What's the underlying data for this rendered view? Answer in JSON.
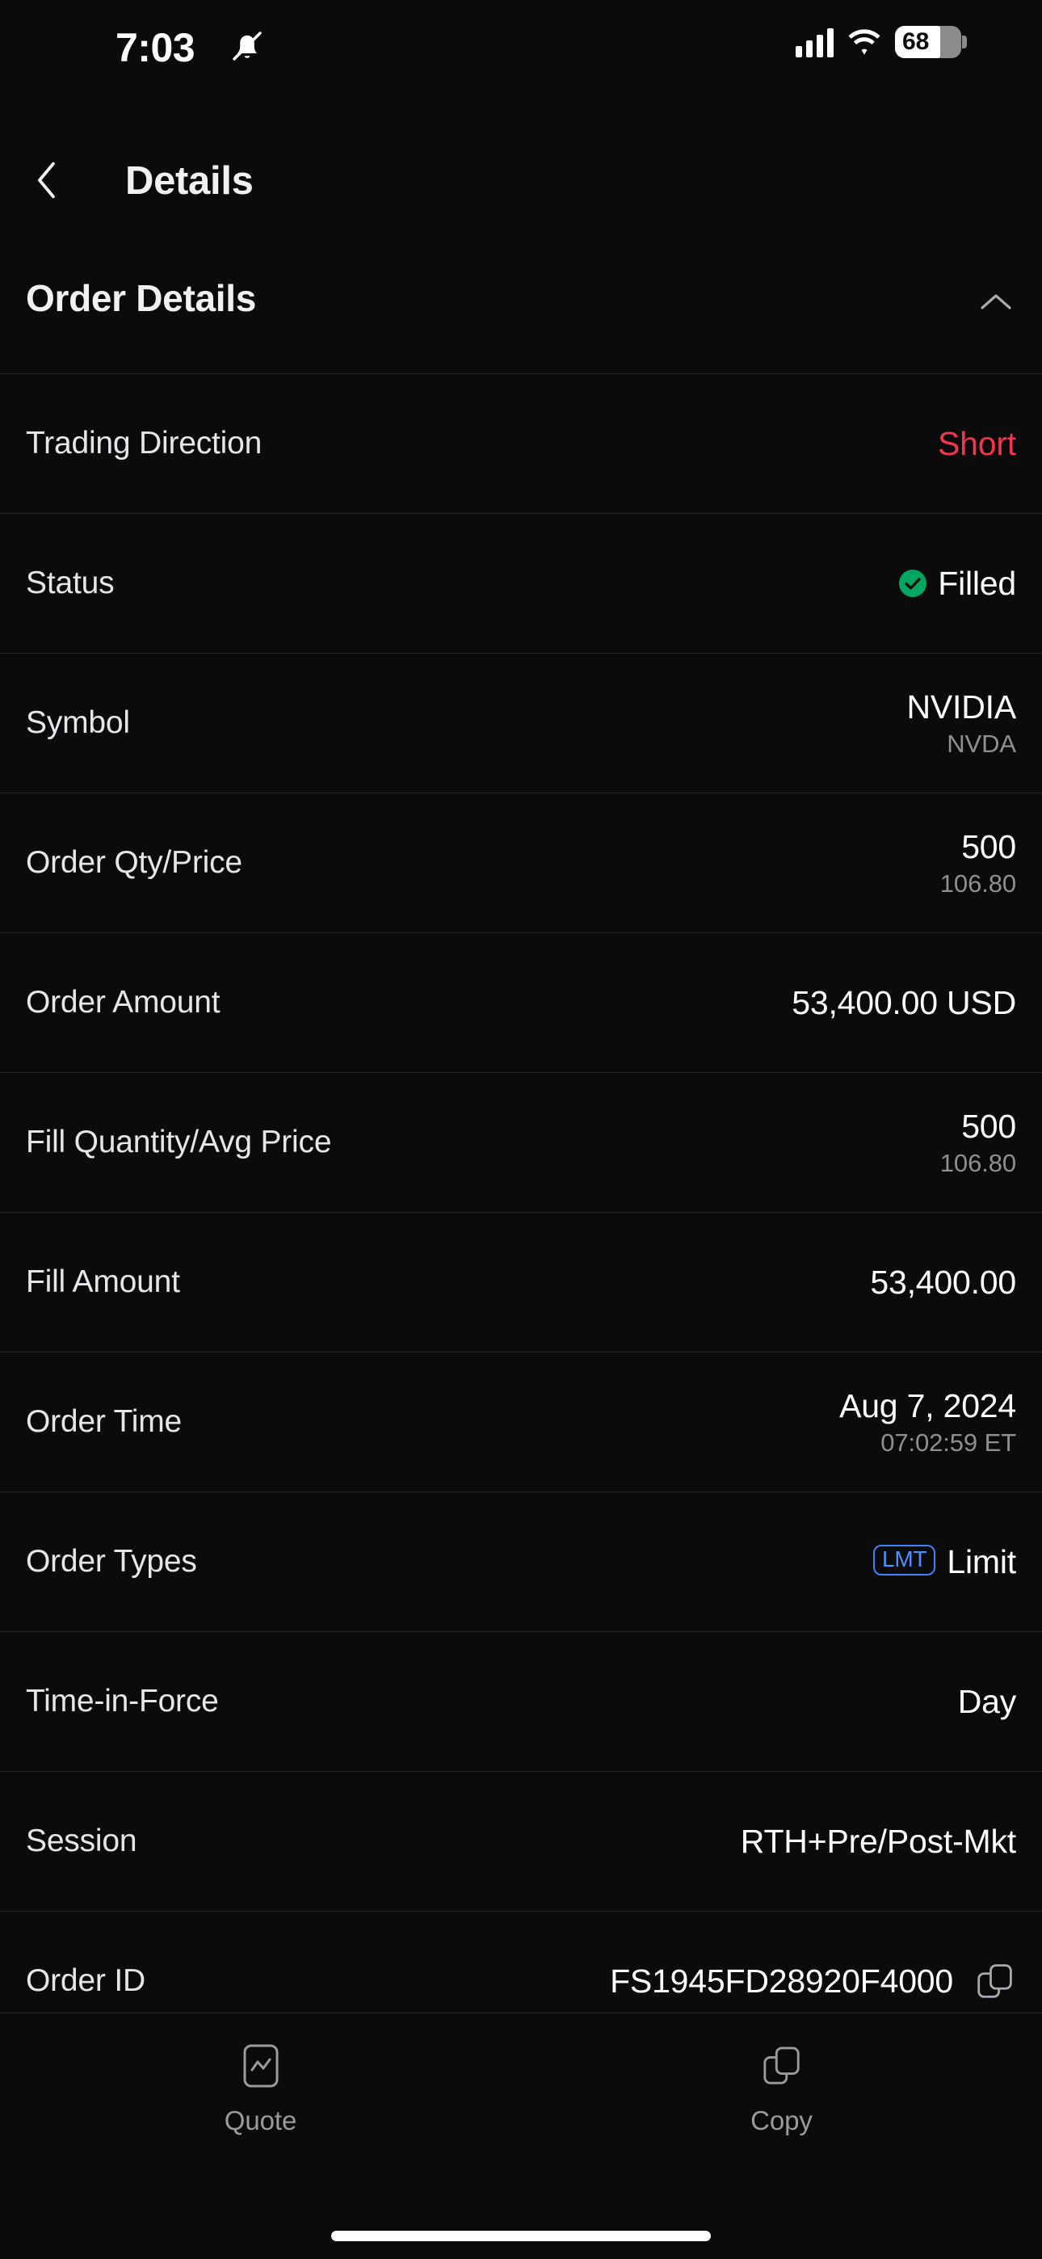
{
  "status_bar": {
    "time": "7:03",
    "silent_icon": "bell-slash-icon",
    "cellular_icon": "cellular-bars-icon",
    "wifi_icon": "wifi-icon",
    "battery_percent": "68"
  },
  "nav": {
    "back_icon": "chevron-left-icon",
    "title": "Details"
  },
  "section": {
    "title": "Order Details",
    "collapse_icon": "chevron-up-icon"
  },
  "colors": {
    "background": "#0b0b0c",
    "divider": "#262628",
    "short_red": "#f2364d",
    "filled_green": "#03a660",
    "badge_blue": "#4a90ff",
    "label_gray": "#e6e6ea",
    "subvalue_gray": "#8e8e93"
  },
  "rows": [
    {
      "label": "Trading Direction",
      "value": "Short",
      "sub": "",
      "style": "short"
    },
    {
      "label": "Status",
      "value": "Filled",
      "sub": "",
      "style": "filled"
    },
    {
      "label": "Symbol",
      "value": "NVIDIA",
      "sub": "NVDA",
      "style": "plain"
    },
    {
      "label": "Order Qty/Price",
      "value": "500",
      "sub": "106.80",
      "style": "plain"
    },
    {
      "label": "Order Amount",
      "value": "53,400.00 USD",
      "sub": "",
      "style": "plain"
    },
    {
      "label": "Fill Quantity/Avg Price",
      "value": "500",
      "sub": "106.80",
      "style": "plain"
    },
    {
      "label": "Fill Amount",
      "value": "53,400.00",
      "sub": "",
      "style": "plain"
    },
    {
      "label": "Order Time",
      "value": "Aug 7, 2024",
      "sub": "07:02:59 ET",
      "style": "plain"
    },
    {
      "label": "Order Types",
      "value": "Limit",
      "sub": "",
      "style": "badge",
      "badge": "LMT"
    },
    {
      "label": "Time-in-Force",
      "value": "Day",
      "sub": "",
      "style": "plain"
    },
    {
      "label": "Session",
      "value": "RTH+Pre/Post-Mkt",
      "sub": "",
      "style": "plain"
    },
    {
      "label": "Order ID",
      "value": "FS1945FD28920F4000",
      "sub": "",
      "style": "copy",
      "copy_icon": "copy-icon"
    }
  ],
  "bottom_bar": {
    "items": [
      {
        "label": "Quote",
        "icon": "quote-chart-icon"
      },
      {
        "label": "Copy",
        "icon": "copy-icon"
      }
    ]
  }
}
